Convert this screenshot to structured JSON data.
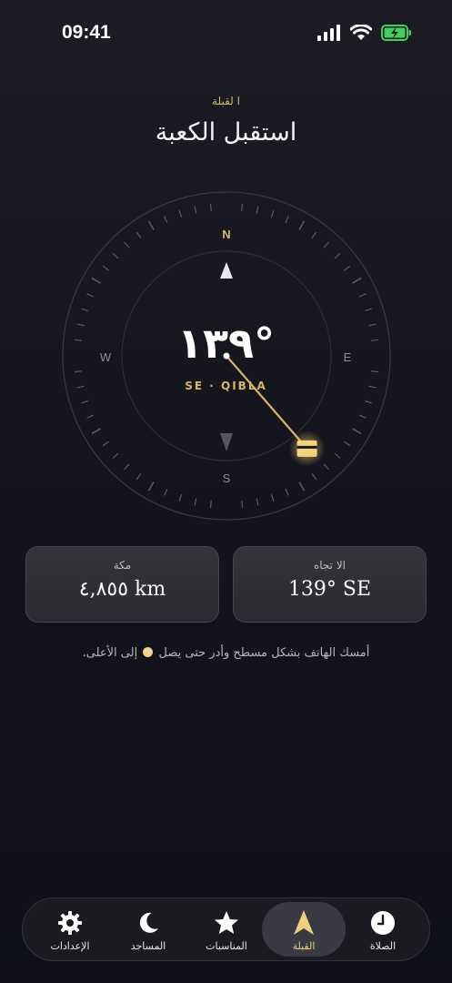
{
  "status_bar": {
    "time": "09:41"
  },
  "header": {
    "eyebrow": "ا لقبلة",
    "title": "استقبل الكعبة"
  },
  "compass": {
    "cardinals": {
      "n": "N",
      "e": "E",
      "s": "S",
      "w": "W"
    },
    "heading_value": "١٣٩°",
    "heading_sub": "SE · QIBLA",
    "qibla_bearing_deg": 139
  },
  "cards": {
    "distance": {
      "label": "مكة",
      "value": "٤,٨٥٥ km"
    },
    "direction": {
      "label": "الا تجاه",
      "value": "139° SE"
    }
  },
  "hint": {
    "before": "أمسك الهاتف بشكل مسطح وأدر حتى يصل",
    "after": "إلى الأعلى."
  },
  "tabs": [
    {
      "label": "الإعدادات",
      "icon": "gear-icon"
    },
    {
      "label": "المساجد",
      "icon": "moon-icon"
    },
    {
      "label": "المناسبات",
      "icon": "star-icon"
    },
    {
      "label": "القبلة",
      "icon": "compass-arrow-icon",
      "active": true
    },
    {
      "label": "الصلاة",
      "icon": "clock-icon"
    }
  ],
  "colors": {
    "accent": "#d6b768",
    "background": "#15151d",
    "active_tab": "#f0cf7a"
  }
}
